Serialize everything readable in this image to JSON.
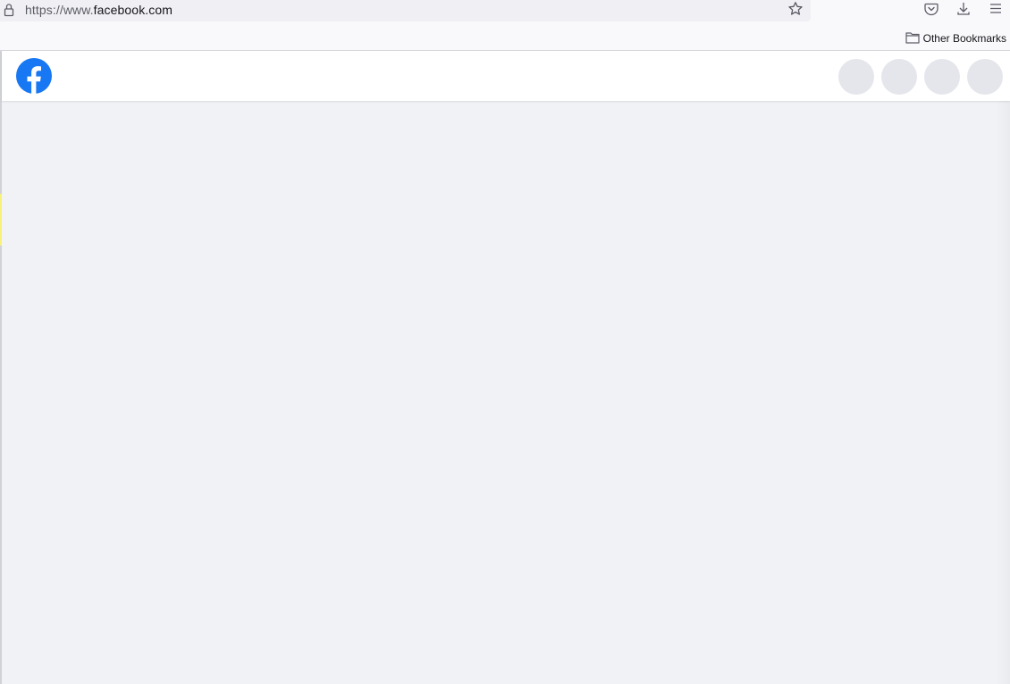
{
  "browser": {
    "url_dim_prefix": "https://www.",
    "url_domain": "facebook.com",
    "bookmarks": {
      "other_label": "Other Bookmarks"
    },
    "icons": [
      "lock-icon",
      "star-icon",
      "pocket-icon",
      "download-icon",
      "menu-icon",
      "folder-icon"
    ]
  },
  "facebook": {
    "brand_color": "#1877f2",
    "header_placeholders": 4,
    "icons": [
      "facebook-logo-icon"
    ]
  },
  "colors": {
    "page_background": "#f0f2f5",
    "placeholder": "#e4e6eb",
    "chrome_background": "#f9f9fb",
    "urlbar_background": "#f0f0f4"
  }
}
